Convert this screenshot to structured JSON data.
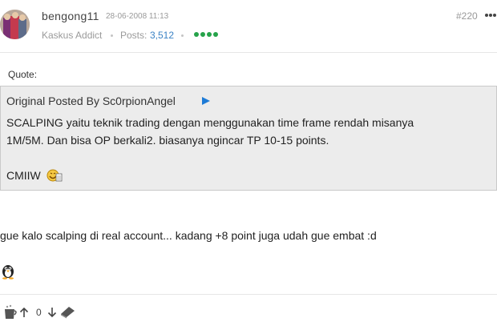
{
  "post": {
    "username": "bengong11",
    "date": "28-06-2008 11:13",
    "number": "#220",
    "rank": "Kaskus Addict",
    "posts_label": "Posts:",
    "posts_count": "3,512",
    "reputation_level": 4
  },
  "quote": {
    "label": "Quote:",
    "origin_prefix": "Original Posted By",
    "author": "Sc0rpionAngel",
    "line1": "SCALPING yaitu teknik trading dengan menggunakan time frame rendah misanya",
    "line2": "1M/5M. Dan bisa OP berkali2. biasanya ngincar TP 10-15 points.",
    "line3": "CMIIW"
  },
  "body": {
    "text": "gue kalo scalping di real account... kadang +8 point juga udah gue embat :d"
  },
  "footer": {
    "vote_count": "0"
  },
  "colors": {
    "link": "#3b83c5",
    "reputation": "#26a34a",
    "quote_bg": "#ececec",
    "arrow": "#1e7bd6"
  }
}
